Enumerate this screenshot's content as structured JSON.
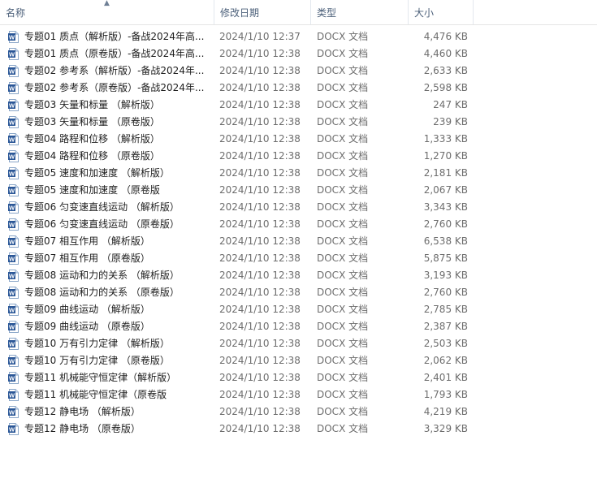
{
  "columns": {
    "name": "名称",
    "date": "修改日期",
    "type": "类型",
    "size": "大小",
    "sort_indicator": "^"
  },
  "file_icon": "word-document-icon",
  "files": [
    {
      "name": "专题01 质点（解析版）-备战2024年高...",
      "date": "2024/1/10 12:37",
      "type": "DOCX 文档",
      "size": "4,476 KB"
    },
    {
      "name": "专题01 质点（原卷版）-备战2024年高...",
      "date": "2024/1/10 12:38",
      "type": "DOCX 文档",
      "size": "4,460 KB"
    },
    {
      "name": "专题02 参考系（解析版）-备战2024年...",
      "date": "2024/1/10 12:38",
      "type": "DOCX 文档",
      "size": "2,633 KB"
    },
    {
      "name": "专题02 参考系（原卷版）-备战2024年...",
      "date": "2024/1/10 12:38",
      "type": "DOCX 文档",
      "size": "2,598 KB"
    },
    {
      "name": "专题03 矢量和标量 （解析版）",
      "date": "2024/1/10 12:38",
      "type": "DOCX 文档",
      "size": "247 KB"
    },
    {
      "name": "专题03 矢量和标量 （原卷版）",
      "date": "2024/1/10 12:38",
      "type": "DOCX 文档",
      "size": "239 KB"
    },
    {
      "name": "专题04 路程和位移 （解析版）",
      "date": "2024/1/10 12:38",
      "type": "DOCX 文档",
      "size": "1,333 KB"
    },
    {
      "name": "专题04 路程和位移 （原卷版）",
      "date": "2024/1/10 12:38",
      "type": "DOCX 文档",
      "size": "1,270 KB"
    },
    {
      "name": "专题05 速度和加速度 （解析版）",
      "date": "2024/1/10 12:38",
      "type": "DOCX 文档",
      "size": "2,181 KB"
    },
    {
      "name": "专题05 速度和加速度 （原卷版",
      "date": "2024/1/10 12:38",
      "type": "DOCX 文档",
      "size": "2,067 KB"
    },
    {
      "name": "专题06 匀变速直线运动 （解析版）",
      "date": "2024/1/10 12:38",
      "type": "DOCX 文档",
      "size": "3,343 KB"
    },
    {
      "name": "专题06 匀变速直线运动 （原卷版）",
      "date": "2024/1/10 12:38",
      "type": "DOCX 文档",
      "size": "2,760 KB"
    },
    {
      "name": "专题07 相互作用 （解析版）",
      "date": "2024/1/10 12:38",
      "type": "DOCX 文档",
      "size": "6,538 KB"
    },
    {
      "name": "专题07 相互作用 （原卷版）",
      "date": "2024/1/10 12:38",
      "type": "DOCX 文档",
      "size": "5,875 KB"
    },
    {
      "name": "专题08 运动和力的关系 （解析版）",
      "date": "2024/1/10 12:38",
      "type": "DOCX 文档",
      "size": "3,193 KB"
    },
    {
      "name": "专题08 运动和力的关系 （原卷版）",
      "date": "2024/1/10 12:38",
      "type": "DOCX 文档",
      "size": "2,760 KB"
    },
    {
      "name": "专题09 曲线运动 （解析版）",
      "date": "2024/1/10 12:38",
      "type": "DOCX 文档",
      "size": "2,785 KB"
    },
    {
      "name": "专题09 曲线运动 （原卷版）",
      "date": "2024/1/10 12:38",
      "type": "DOCX 文档",
      "size": "2,387 KB"
    },
    {
      "name": "专题10 万有引力定律 （解析版）",
      "date": "2024/1/10 12:38",
      "type": "DOCX 文档",
      "size": "2,503 KB"
    },
    {
      "name": "专题10 万有引力定律 （原卷版）",
      "date": "2024/1/10 12:38",
      "type": "DOCX 文档",
      "size": "2,062 KB"
    },
    {
      "name": "专题11 机械能守恒定律（解析版）",
      "date": "2024/1/10 12:38",
      "type": "DOCX 文档",
      "size": "2,401 KB"
    },
    {
      "name": "专题11 机械能守恒定律（原卷版",
      "date": "2024/1/10 12:38",
      "type": "DOCX 文档",
      "size": "1,793 KB"
    },
    {
      "name": "专题12 静电场 （解析版）",
      "date": "2024/1/10 12:38",
      "type": "DOCX 文档",
      "size": "4,219 KB"
    },
    {
      "name": "专题12 静电场 （原卷版）",
      "date": "2024/1/10 12:38",
      "type": "DOCX 文档",
      "size": "3,329 KB"
    }
  ]
}
